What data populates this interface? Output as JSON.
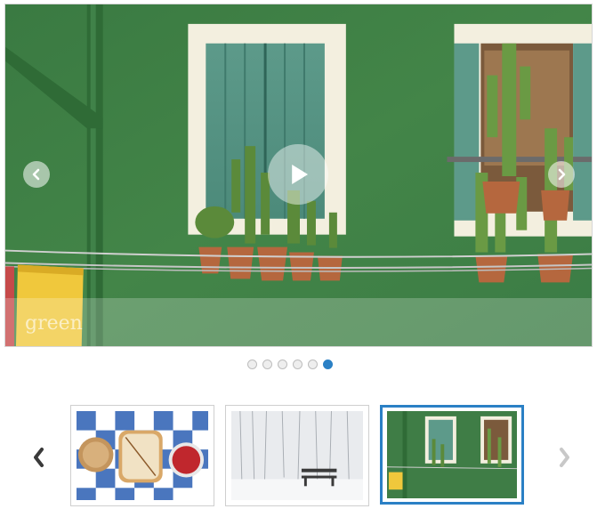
{
  "slideshow": {
    "caption": "green",
    "slide_count": 6,
    "active_slide": 6,
    "controls": {
      "prev_icon": "chevron-left-icon",
      "next_icon": "chevron-right-icon",
      "play_icon": "play-icon"
    }
  },
  "thumbnails": [
    {
      "name": "thumbnail-peanut-butter-sandwich",
      "active": false
    },
    {
      "name": "thumbnail-snowy-bench",
      "active": false
    },
    {
      "name": "thumbnail-green-wall",
      "active": true
    }
  ],
  "colors": {
    "accent": "#2b80c5",
    "wall_green": "#3f7d46"
  }
}
